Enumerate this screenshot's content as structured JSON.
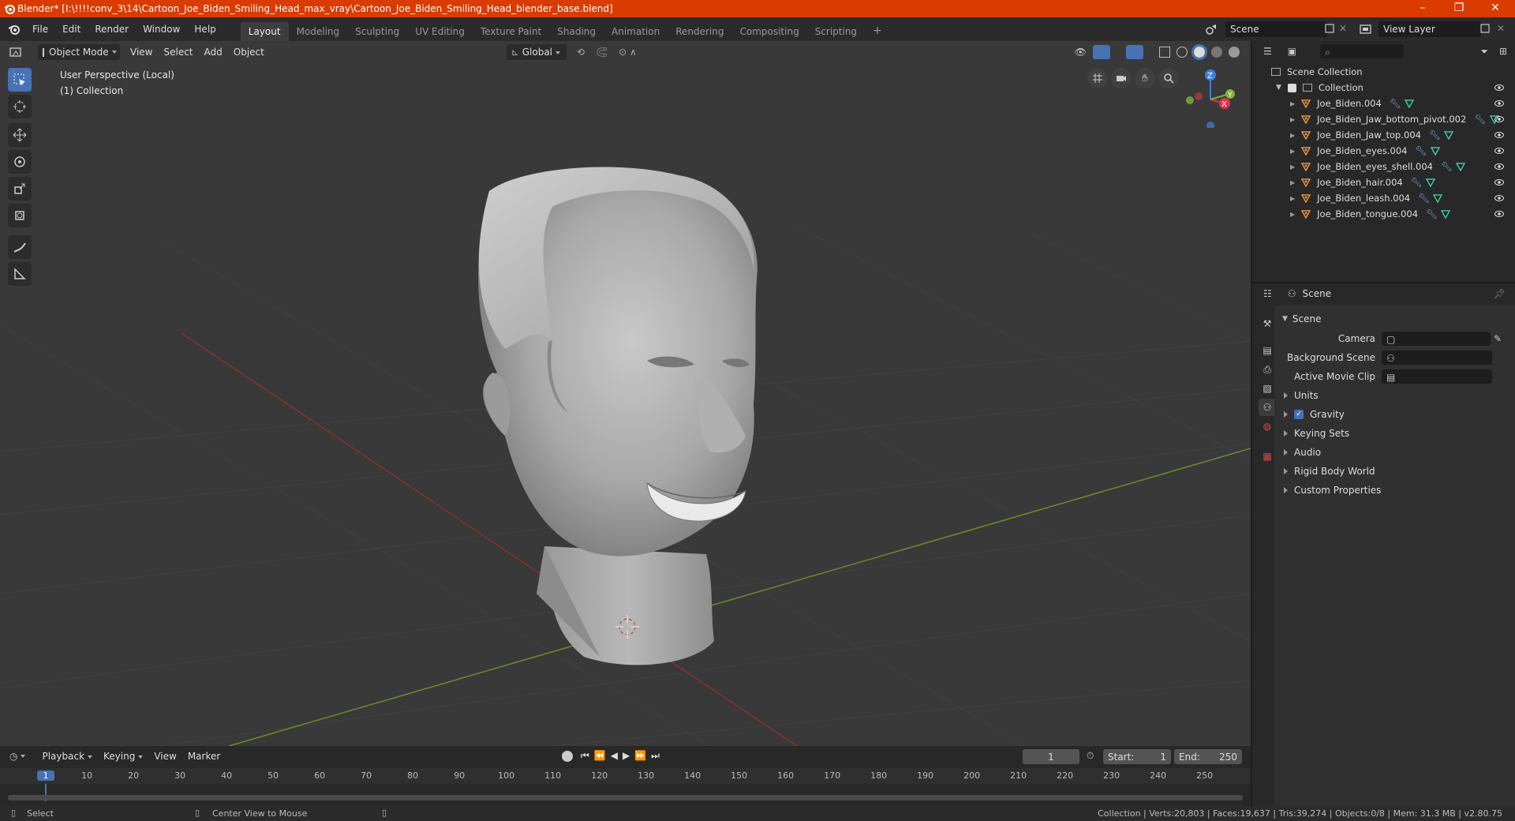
{
  "window": {
    "title": "Blender* [I:\\!!!!conv_3\\14\\Cartoon_Joe_Biden_Smiling_Head_max_vray\\Cartoon_Joe_Biden_Smiling_Head_blender_base.blend]",
    "minimize": "–",
    "maximize": "❐",
    "close": "✕"
  },
  "menu": [
    "File",
    "Edit",
    "Render",
    "Window",
    "Help"
  ],
  "workspaces": [
    {
      "label": "Layout",
      "active": true
    },
    {
      "label": "Modeling"
    },
    {
      "label": "Sculpting"
    },
    {
      "label": "UV Editing"
    },
    {
      "label": "Texture Paint"
    },
    {
      "label": "Shading"
    },
    {
      "label": "Animation"
    },
    {
      "label": "Rendering"
    },
    {
      "label": "Compositing"
    },
    {
      "label": "Scripting"
    }
  ],
  "add_workspace": "+",
  "scene_field": "Scene",
  "view_layer_field": "View Layer",
  "viewport": {
    "mode": "Object Mode",
    "menus": [
      "View",
      "Select",
      "Add",
      "Object"
    ],
    "orientation": "Global",
    "perspective_label": "User Perspective (Local)",
    "collection_label": "(1) Collection",
    "gizmo_axes": {
      "x": "X",
      "y": "Y",
      "z": "Z"
    }
  },
  "outliner": {
    "search_placeholder": "",
    "root": "Scene Collection",
    "collection": "Collection",
    "objects": [
      "Joe_Biden.004",
      "Joe_Biden_Jaw_bottom_pivot.002",
      "Joe_Biden_Jaw_top.004",
      "Joe_Biden_eyes.004",
      "Joe_Biden_eyes_shell.004",
      "Joe_Biden_hair.004",
      "Joe_Biden_leash.004",
      "Joe_Biden_tongue.004"
    ]
  },
  "properties": {
    "header": "Scene",
    "section": "Scene",
    "camera_label": "Camera",
    "background_scene_label": "Background Scene",
    "active_movie_clip_label": "Active Movie Clip",
    "subpanels": [
      "Units",
      "Gravity",
      "Keying Sets",
      "Audio",
      "Rigid Body World",
      "Custom Properties"
    ],
    "gravity_checked": true
  },
  "timeline": {
    "menus": [
      "Playback",
      "Keying",
      "View",
      "Marker"
    ],
    "current_frame": "1",
    "start_label": "Start:",
    "start_value": "1",
    "end_label": "End:",
    "end_value": "250",
    "ruler": [
      "1",
      "10",
      "20",
      "30",
      "40",
      "50",
      "60",
      "70",
      "80",
      "90",
      "100",
      "110",
      "120",
      "130",
      "140",
      "150",
      "160",
      "170",
      "180",
      "190",
      "200",
      "210",
      "220",
      "230",
      "240",
      "250"
    ]
  },
  "status": {
    "left_action": "Select",
    "mid_action": "Center View to Mouse",
    "stats": "Collection | Verts:20,803 | Faces:19,637 | Tris:39,274 | Objects:0/8 | Mem: 31.3 MB | v2.80.75"
  }
}
